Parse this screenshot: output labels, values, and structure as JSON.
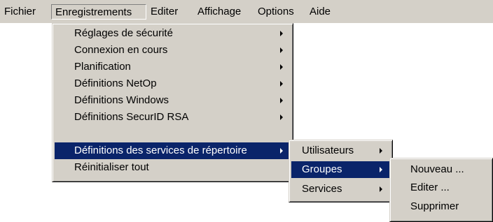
{
  "menubar": {
    "items": [
      {
        "label": "Fichier"
      },
      {
        "label": "Enregistrements"
      },
      {
        "label": "Editer"
      },
      {
        "label": "Affichage"
      },
      {
        "label": "Options"
      },
      {
        "label": "Aide"
      }
    ]
  },
  "enregistrements_menu": {
    "items": [
      {
        "label": "Réglages de sécurité",
        "submenu": true
      },
      {
        "label": "Connexion en cours",
        "submenu": true
      },
      {
        "label": "Planification",
        "submenu": true
      },
      {
        "label": "Définitions NetOp",
        "submenu": true
      },
      {
        "label": "Définitions Windows",
        "submenu": true
      },
      {
        "label": "Définitions SecurID RSA",
        "submenu": true
      },
      {
        "label": "Définitions des services de répertoire",
        "submenu": true,
        "highlighted": true
      },
      {
        "label": "Réinitialiser tout",
        "submenu": false
      }
    ]
  },
  "services_repertoire_menu": {
    "items": [
      {
        "label": "Utilisateurs",
        "submenu": true
      },
      {
        "label": "Groupes",
        "submenu": true,
        "highlighted": true
      },
      {
        "label": "Services",
        "submenu": true
      }
    ]
  },
  "groupes_menu": {
    "items": [
      {
        "label": "Nouveau ..."
      },
      {
        "label": "Editer ..."
      },
      {
        "label": "Supprimer"
      }
    ]
  },
  "colors": {
    "menu_face": "#d4d0c8",
    "highlight": "#0a246a",
    "highlight_text": "#ffffff"
  }
}
